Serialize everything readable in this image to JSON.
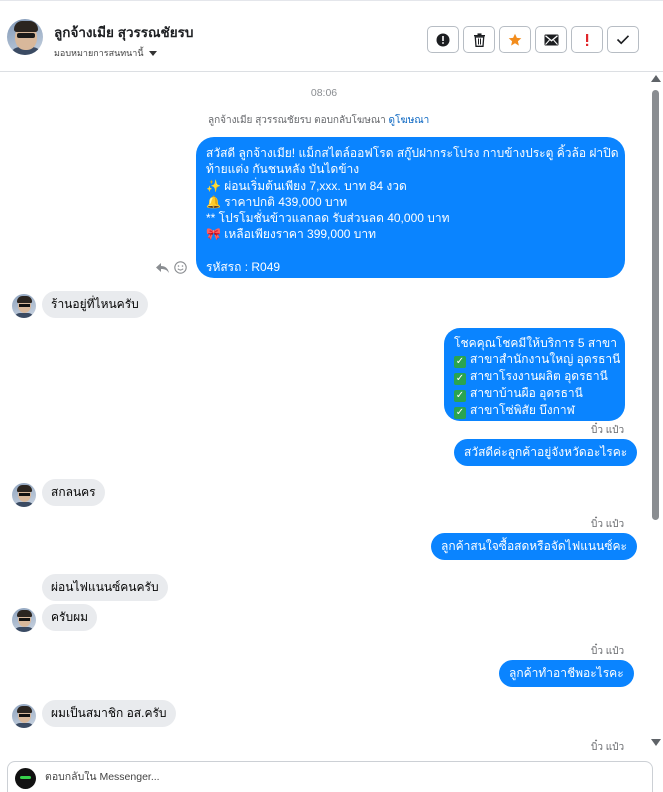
{
  "header": {
    "name": "ลูกจ้างเมีย สุวรรณชัยรบ",
    "assign_label": "มอบหมายการสนทนานี้",
    "actions": [
      "mark-spam",
      "delete",
      "star",
      "email",
      "important",
      "done"
    ]
  },
  "thread": {
    "timestamp": "08:06",
    "reply_note_prefix": "ลูกจ้างเมีย สุวรรณชัยรบ ตอบกลับโฆษณา",
    "reply_note_link": "ดูโฆษณา",
    "ad_message": {
      "lines": [
        "สวัสดี ลูกจ้างเมีย! แม็กสไตล์ออฟโรด สกู๊ปฝากระโปรง กาบข้างประตู คิ้วล้อ ฝาปิด",
        "ท้ายแต่ง กันชนหลัง บันไดข้าง",
        "✨  ผ่อนเริ่มต้นเพียง 7,xxx. บาท 84 งวด",
        "🔔 ราคาปกติ 439,000 บาท",
        "** โปรโมชั่นข้าวแลกลด รับส่วนลด 40,000 บาท",
        "🎀  เหลือเพียงราคา 399,000 บาท",
        "",
        "รหัสรถ : R049"
      ]
    },
    "messages": [
      {
        "dir": "in",
        "text": "ร้านอยู่ที่ไหนครับ"
      },
      {
        "dir": "out",
        "title": "โชคคุณโชคมีให้บริการ 5 สาขา",
        "items": [
          "สาขาสำนักงานใหญ่ อุดรธานี",
          "สาขาโรงงานผลิต อุดรธานี",
          "สาขาบ้านผือ อุดรธานี",
          "สาขาโซ่พิสัย บึงกาฬ"
        ],
        "sender": "บิ๋ว แป๋ว"
      },
      {
        "dir": "out",
        "text": "สวัสดีค่ะลูกค้าอยู่จังหวัดอะไรคะ"
      },
      {
        "dir": "in",
        "text": "สกลนคร"
      },
      {
        "dir": "out",
        "text": "ลูกค้าสนใจซื้อสดหรือจัดไฟแนนซ์คะ",
        "sender": "บิ๋ว แป๋ว"
      },
      {
        "dir": "in",
        "text": "ผ่อนไฟแนนซ์คนครับ"
      },
      {
        "dir": "in",
        "text": "ครับผม"
      },
      {
        "dir": "out",
        "text": "ลูกค้าทำอาชีพอะไรคะ",
        "sender": "บิ๋ว แป๋ว"
      },
      {
        "dir": "in",
        "text": "ผมเป็นสมาชิก อส.ครับ"
      },
      {
        "dir": "out",
        "sender": "บิ๋ว แป๋ว"
      }
    ]
  },
  "composer": {
    "placeholder": "ตอบกลับใน Messenger..."
  },
  "colors": {
    "outgoing_bubble": "#0a84ff",
    "incoming_bubble": "#e9ebee",
    "star": "#f28c1c",
    "important": "#e0262b"
  }
}
